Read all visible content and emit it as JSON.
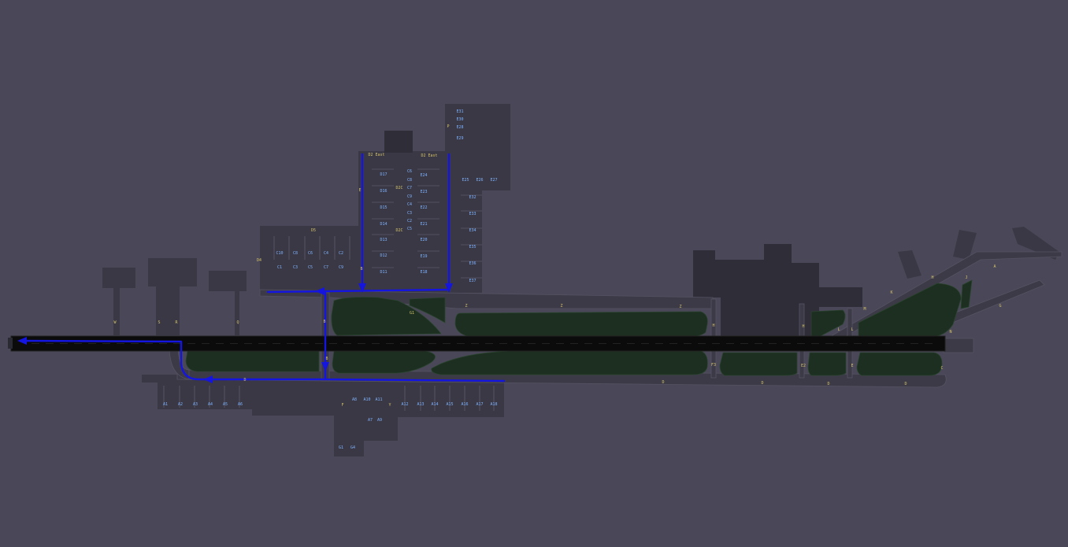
{
  "route_color": "#1515e0",
  "grass_color": "#1d2f20",
  "runway_color": "#0b0b0b",
  "background_color": "#4a4858",
  "area_labels": {
    "d2_east_left": "D2 East",
    "d2_east_right": "D2 East"
  },
  "gates": {
    "a_row": [
      "A1",
      "A2",
      "A3",
      "A4",
      "A5",
      "A6"
    ],
    "a_mid": [
      "A8",
      "A10",
      "A11",
      "A7",
      "A9"
    ],
    "a_east": [
      "A12",
      "A13",
      "A14",
      "A15",
      "A16",
      "A17",
      "A18"
    ],
    "g_row": [
      "G1",
      "G4"
    ],
    "c_row_top": [
      "C10",
      "C8",
      "C6",
      "C4",
      "C2"
    ],
    "c_row_bottom": [
      "C1",
      "C3",
      "C5",
      "C7",
      "C9"
    ],
    "d_left": [
      "D17",
      "D16",
      "D15",
      "D14",
      "D13",
      "D12",
      "D11"
    ],
    "d_center": [
      "C6",
      "C8",
      "C7",
      "C9",
      "C4",
      "C3",
      "C2",
      "C5"
    ],
    "d_right": [
      "E24",
      "E23",
      "E22",
      "E21",
      "E20",
      "E19",
      "E18"
    ],
    "e_north": [
      "E31",
      "E30",
      "E28",
      "E29"
    ],
    "e_east_top": [
      "E25",
      "E26",
      "E27"
    ],
    "e_east": [
      "E32",
      "E33",
      "E34",
      "E35",
      "E36",
      "E37"
    ]
  },
  "taxiway_labels": {
    "w": "W",
    "s": "S",
    "r": "R",
    "q": "Q",
    "d5": "D5",
    "d4": "D4",
    "b": "B",
    "e": "E",
    "d2c": "D2C",
    "d2c2": "D2C",
    "z1": "Z",
    "z2": "Z",
    "z3": "Z",
    "g1": "G1",
    "p": "P",
    "y": "Y",
    "f": "F",
    "h1": "H",
    "h2": "H",
    "h3": "H",
    "j": "J",
    "k": "K",
    "l1": "L",
    "l2": "L",
    "m": "M",
    "n": "N",
    "a": "A",
    "g": "G",
    "d1": "D",
    "d2": "D",
    "d3": "D",
    "d4b": "D",
    "d5b": "D",
    "c": "C",
    "e2": "E2",
    "f3": "F3",
    "e4": "E",
    "b2": "B",
    "b3": "B"
  }
}
